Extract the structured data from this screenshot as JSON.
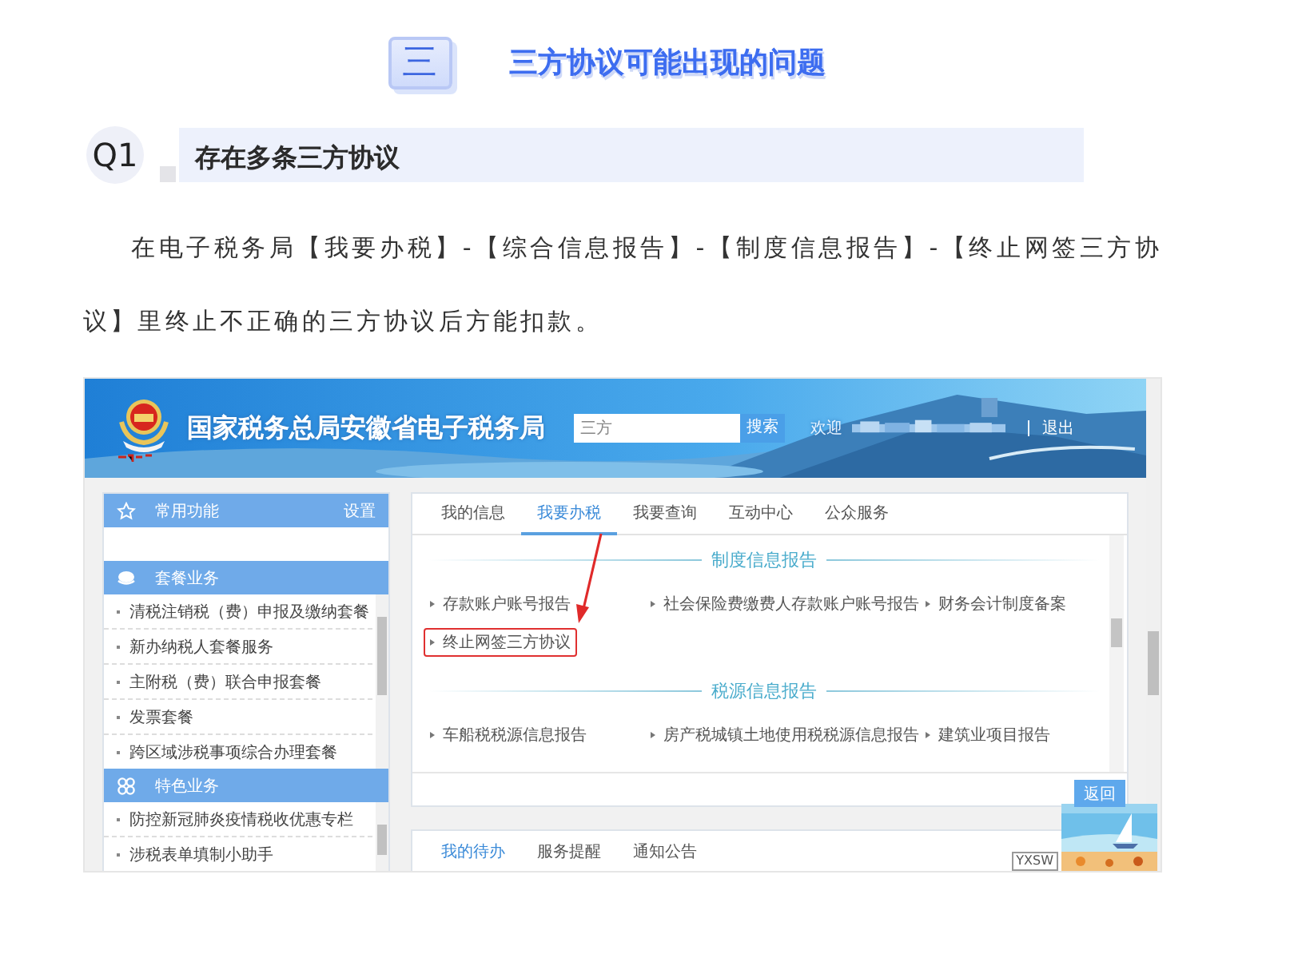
{
  "header": {
    "badge": "三",
    "title": "三方协议可能出现的问题"
  },
  "question": {
    "number": "Q1",
    "title": "存在多条三方协议"
  },
  "paragraph": "在电子税务局【我要办税】-【综合信息报告】-【制度信息报告】-【终止网签三方协议】里终止不正确的三方协议后方能扣款。",
  "screenshot": {
    "site_title": "国家税务总局安徽省电子税务局",
    "search": {
      "value": "三方"
    },
    "search_button": "搜索",
    "welcome": "欢迎",
    "logout": "退出",
    "sidebar": [
      {
        "title": "常用功能",
        "kind": "star",
        "action": "设置"
      },
      {
        "title": "套餐业务",
        "kind": "layers",
        "items": [
          "清税注销税（费）申报及缴纳套餐",
          "新办纳税人套餐服务",
          "主附税（费）联合申报套餐",
          "发票套餐",
          "跨区域涉税事项综合办理套餐"
        ]
      },
      {
        "title": "特色业务",
        "kind": "clover",
        "items": [
          "防控新冠肺炎疫情税收优惠专栏",
          "涉税表单填制小助手"
        ]
      }
    ],
    "tabs": [
      {
        "label": "我的信息",
        "selected": false
      },
      {
        "label": "我要办税",
        "selected": true
      },
      {
        "label": "我要查询",
        "selected": false
      },
      {
        "label": "互动中心",
        "selected": false
      },
      {
        "label": "公众服务",
        "selected": false
      }
    ],
    "sections": [
      {
        "title": "制度信息报告",
        "links": [
          {
            "text": "存款账户账号报告",
            "highlighted": false
          },
          {
            "text": "社会保险费缴费人存款账户账号报告",
            "highlighted": false
          },
          {
            "text": "财务会计制度备案",
            "highlighted": false
          },
          {
            "text": "终止网签三方协议",
            "highlighted": true
          }
        ]
      },
      {
        "title": "税源信息报告",
        "links": [
          {
            "text": "车船税税源信息报告",
            "highlighted": false
          },
          {
            "text": "房产税城镇土地使用税税源信息报告",
            "highlighted": false
          },
          {
            "text": "建筑业项目报告",
            "highlighted": false
          }
        ]
      }
    ],
    "back_button": "返回",
    "bottom_tabs": [
      {
        "label": "我的待办",
        "selected": true
      },
      {
        "label": "服务提醒",
        "selected": false
      },
      {
        "label": "通知公告",
        "selected": false
      }
    ],
    "ad_label": "YXSW"
  }
}
